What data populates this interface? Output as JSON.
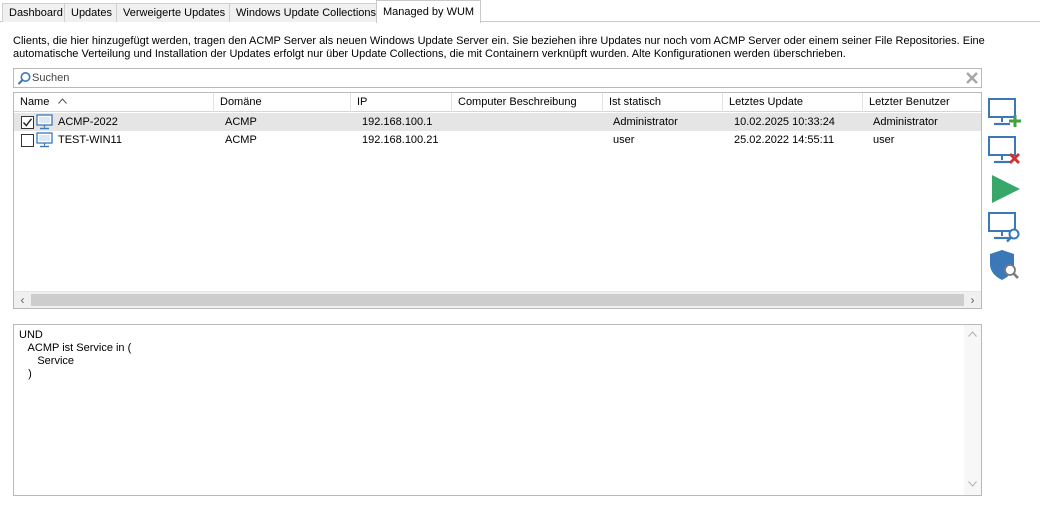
{
  "tabs": [
    {
      "label": "Dashboard",
      "active": false
    },
    {
      "label": "Updates",
      "active": false
    },
    {
      "label": "Verweigerte Updates",
      "active": false
    },
    {
      "label": "Windows Update Collections",
      "active": false
    },
    {
      "label": "Managed by WUM",
      "active": true
    }
  ],
  "description": "Clients, die hier hinzugefügt werden, tragen den ACMP Server als neuen Windows Update Server ein. Sie beziehen ihre Updates nur noch vom ACMP Server oder einem seiner File Repositories. Eine automatische Verteilung und Installation der Updates erfolgt nur über Update Collections, die mit Containern verknüpft wurden. Alte Konfigurationen werden überschrieben.",
  "search": {
    "placeholder": "Suchen",
    "value": ""
  },
  "table": {
    "columns": [
      "Name",
      "Domäne",
      "IP",
      "Computer Beschreibung",
      "Ist statisch",
      "Letztes Update",
      "Letzter Benutzer"
    ],
    "sorted_column": "Name",
    "rows": [
      {
        "checked": true,
        "name": "ACMP-2022",
        "domain": "ACMP",
        "ip": "192.168.100.1",
        "description": "",
        "static": "Administrator",
        "last_update": "10.02.2025 10:33:24",
        "last_user": "Administrator"
      },
      {
        "checked": false,
        "name": "TEST-WIN11",
        "domain": "ACMP",
        "ip": "192.168.100.21",
        "description": "",
        "static": "user",
        "last_update": "25.02.2022 14:55:11",
        "last_user": "user"
      }
    ]
  },
  "expression": "UND\n   ACMP ist Service in (\n      Service\n   )",
  "toolbar": {
    "add_client": "monitor-add-icon",
    "remove_client": "monitor-remove-icon",
    "run": "play-icon",
    "find_client": "monitor-search-icon",
    "shield_search": "shield-search-icon"
  },
  "colors": {
    "accent_blue": "#3a78b8",
    "add_green": "#43a047",
    "remove_red": "#d32f2f",
    "play_green": "#38a86a",
    "selected_row": "#e5e5e5"
  }
}
